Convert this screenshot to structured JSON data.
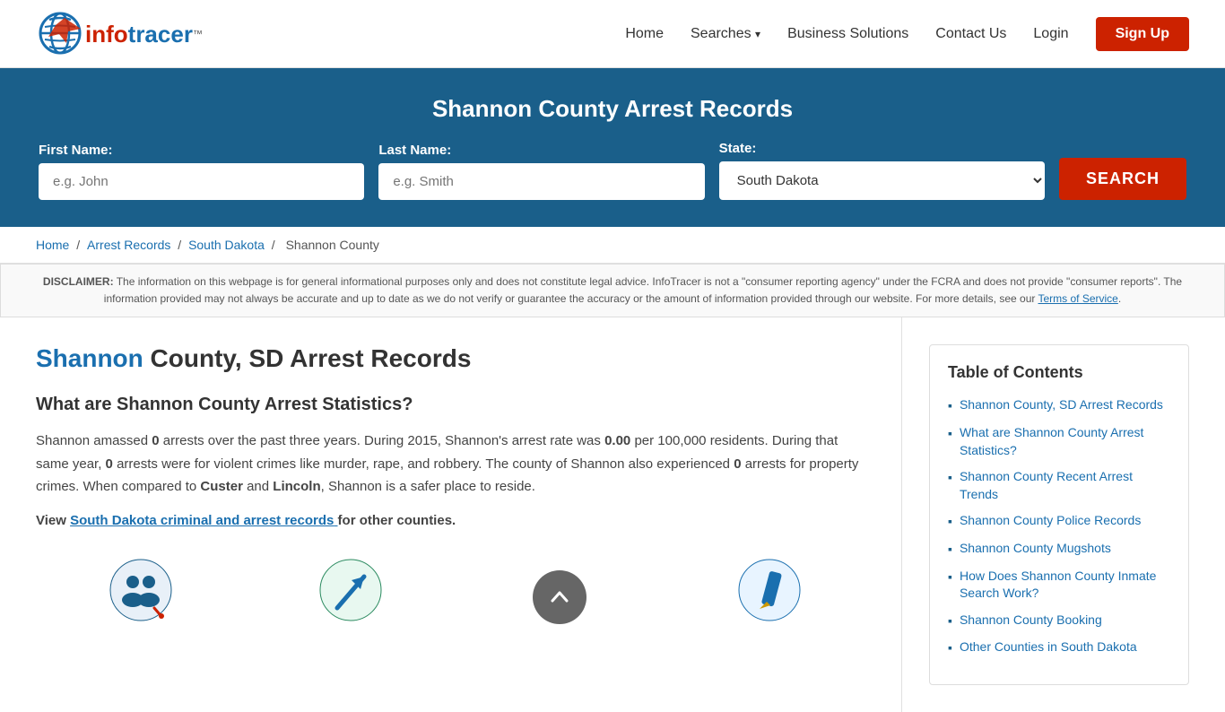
{
  "header": {
    "logo_alt": "InfoTracer",
    "logo_info": "info",
    "logo_tracer": "tracer",
    "logo_tm": "™",
    "nav": {
      "home": "Home",
      "searches": "Searches",
      "searches_arrow": "▾",
      "business_solutions": "Business Solutions",
      "contact_us": "Contact Us",
      "login": "Login",
      "signup": "Sign Up"
    }
  },
  "search_section": {
    "title": "Shannon County Arrest Records",
    "first_name_label": "First Name:",
    "first_name_placeholder": "e.g. John",
    "last_name_label": "Last Name:",
    "last_name_placeholder": "e.g. Smith",
    "state_label": "State:",
    "state_value": "South Dakota",
    "search_button": "SEARCH"
  },
  "breadcrumb": {
    "home": "Home",
    "arrest_records": "Arrest Records",
    "south_dakota": "South Dakota",
    "shannon_county": "Shannon County"
  },
  "disclaimer": {
    "label": "DISCLAIMER:",
    "text": "The information on this webpage is for general informational purposes only and does not constitute legal advice. InfoTracer is not a \"consumer reporting agency\" under the FCRA and does not provide \"consumer reports\". The information provided may not always be accurate and up to date as we do not verify or guarantee the accuracy or the amount of information provided through our website. For more details, see our",
    "link_text": "Terms of Service",
    "end": "."
  },
  "main": {
    "page_title_highlight": "Shannon",
    "page_title_rest": " County, SD Arrest Records",
    "section_title": "What are Shannon County Arrest Statistics?",
    "paragraph": "Shannon amassed",
    "arrests_count": "0",
    "paragraph2": "arrests over the past three years. During 2015, Shannon's arrest rate was",
    "arrest_rate": "0.00",
    "paragraph3": "per 100,000 residents. During that same year,",
    "violent_count": "0",
    "paragraph4": "arrests were for violent crimes like murder, rape, and robbery. The county of Shannon also experienced",
    "property_count": "0",
    "paragraph5": "arrests for property crimes. When compared to",
    "county1": "Custer",
    "and_text": "and",
    "county2": "Lincoln",
    "paragraph6": ", Shannon is a safer place to reside.",
    "view_prefix": "View",
    "view_link_text": "South Dakota criminal and arrest records",
    "view_suffix": "for other counties."
  },
  "toc": {
    "title": "Table of Contents",
    "items": [
      {
        "label": "Shannon County, SD Arrest Records",
        "href": "#"
      },
      {
        "label": "What are Shannon County Arrest Statistics?",
        "href": "#"
      },
      {
        "label": "Shannon County Recent Arrest Trends",
        "href": "#"
      },
      {
        "label": "Shannon County Police Records",
        "href": "#"
      },
      {
        "label": "Shannon County Mugshots",
        "href": "#"
      },
      {
        "label": "How Does Shannon County Inmate Search Work?",
        "href": "#"
      },
      {
        "label": "Shannon County Booking",
        "href": "#"
      },
      {
        "label": "Other Counties in South Dakota",
        "href": "#"
      }
    ]
  }
}
